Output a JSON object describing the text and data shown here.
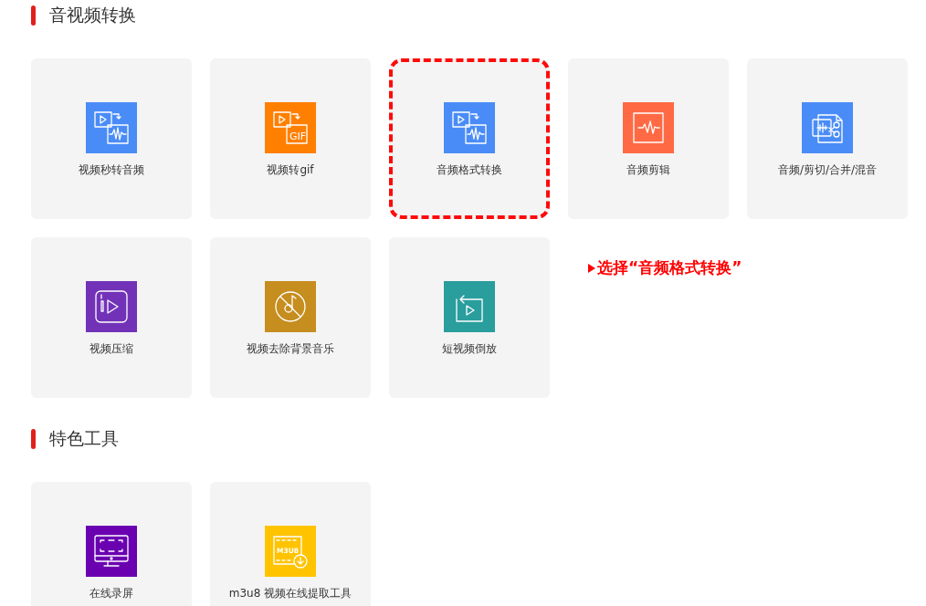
{
  "sections": [
    {
      "title": "音视频转换",
      "tools": [
        {
          "label": "视频秒转音频",
          "kind": "video-audio",
          "color": "#4a8cf7",
          "selected": false
        },
        {
          "label": "视频转gif",
          "kind": "video-gif",
          "icon_text": "GIF",
          "color": "#ff7f00",
          "selected": false
        },
        {
          "label": "音频格式转换",
          "kind": "video-audio",
          "color": "#4a8cf7",
          "selected": true
        },
        {
          "label": "音频剪辑",
          "kind": "wave",
          "color": "#ff6a45",
          "selected": false
        },
        {
          "label": "音频/剪切/合并/混音",
          "kind": "cut",
          "color": "#4a8cf7",
          "selected": false
        },
        {
          "label": "视频压缩",
          "kind": "compress",
          "color": "#7232b8",
          "selected": false
        },
        {
          "label": "视频去除背景音乐",
          "kind": "no-music",
          "color": "#c68d1f",
          "selected": false
        },
        {
          "label": "短视频倒放",
          "kind": "reverse",
          "color": "#2a9d9d",
          "selected": false
        }
      ]
    },
    {
      "title": "特色工具",
      "tools": [
        {
          "label": "在线录屏",
          "kind": "screen",
          "color": "#6a00b0",
          "selected": false
        },
        {
          "label": "m3u8 视频在线提取工具",
          "kind": "m3u8",
          "icon_text": "M3U8",
          "color": "#ffc300",
          "selected": false
        }
      ]
    }
  ],
  "annotation": {
    "text": "选择“音频格式转换”"
  }
}
